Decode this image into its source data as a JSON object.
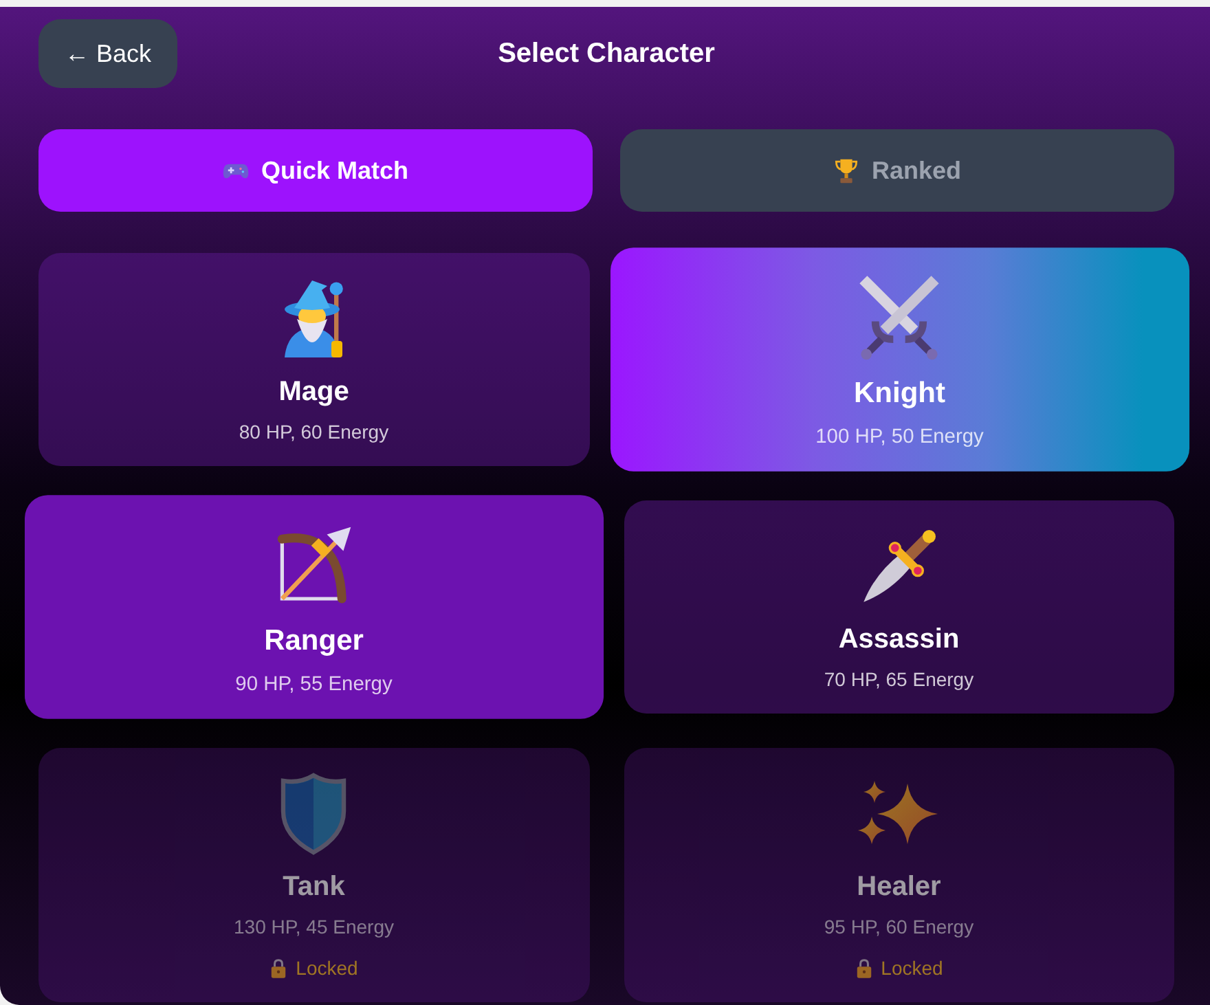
{
  "header": {
    "back_label": "← Back",
    "title": "Select Character"
  },
  "modes": [
    {
      "label": "Quick Match",
      "selected": true
    },
    {
      "label": "Ranked",
      "selected": false
    }
  ],
  "characters": [
    {
      "name": "Mage",
      "stats": "80 HP, 60 Energy",
      "selected": false,
      "hovered": false,
      "locked": false
    },
    {
      "name": "Knight",
      "stats": "100 HP, 50 Energy",
      "selected": true,
      "hovered": false,
      "locked": false
    },
    {
      "name": "Ranger",
      "stats": "90 HP, 55 Energy",
      "selected": false,
      "hovered": true,
      "locked": false
    },
    {
      "name": "Assassin",
      "stats": "70 HP, 65 Energy",
      "selected": false,
      "hovered": false,
      "locked": false
    },
    {
      "name": "Tank",
      "stats": "130 HP, 45 Energy",
      "selected": false,
      "hovered": false,
      "locked": true,
      "lock_label": "Locked"
    },
    {
      "name": "Healer",
      "stats": "95 HP, 60 Energy",
      "selected": false,
      "hovered": false,
      "locked": true,
      "lock_label": "Locked"
    }
  ]
}
